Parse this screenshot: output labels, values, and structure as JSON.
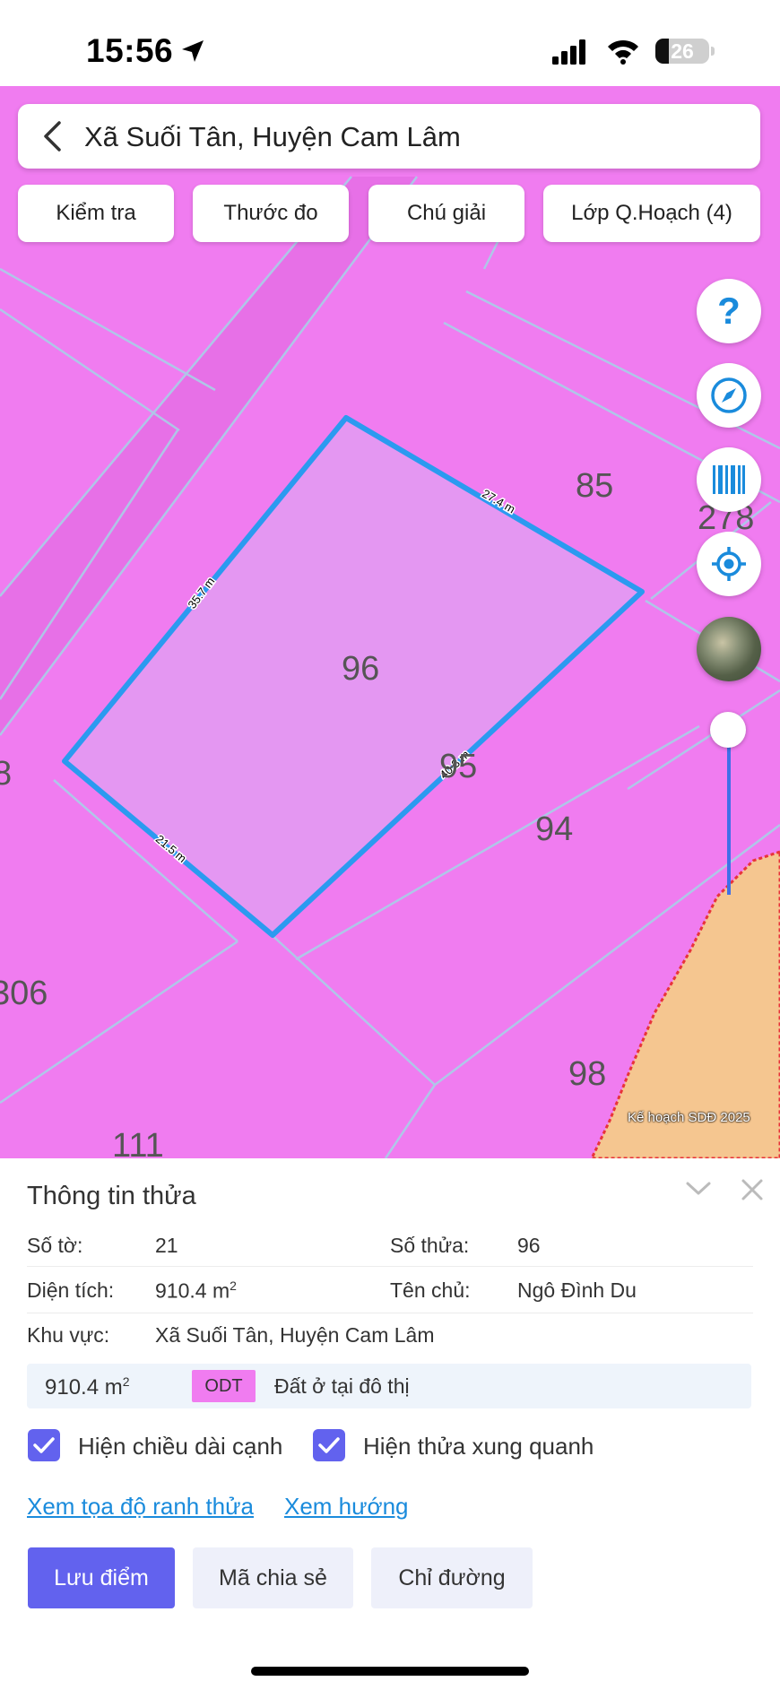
{
  "status_bar": {
    "time": "15:56",
    "battery": "26"
  },
  "map": {
    "location_title": "Xã Suối Tân, Huyện Cam Lâm",
    "tools": [
      "Kiểm tra",
      "Thước đo",
      "Chú giải",
      "Lớp Q.Hoạch (4)"
    ],
    "help_glyph": "?",
    "parcel_numbers": [
      "96",
      "85",
      "278",
      "95",
      "94",
      "98",
      "306",
      "111",
      "8"
    ],
    "edge_lengths": [
      "35.7 m",
      "27.4 m",
      "40.3 m",
      "21.5 m"
    ],
    "attribution": "Kế hoạch SDĐ 2025",
    "colors": {
      "residential": "#f07cf0",
      "selected_fill": "#e497f2",
      "selected_edge": "#2b9af0",
      "other_zone": "#f5c690"
    }
  },
  "panel": {
    "title": "Thông tin thửa",
    "sheet_label": "Số tờ:",
    "sheet_value": "21",
    "parcel_label": "Số thửa:",
    "parcel_value": "96",
    "area_label": "Diện tích:",
    "area_value": "910.4 m",
    "area_unit_sup": "2",
    "owner_label": "Tên chủ:",
    "owner_value": "Ngô Đình Du",
    "region_label": "Khu vực:",
    "region_value": "Xã Suối Tân, Huyện Cam Lâm",
    "land_use": {
      "area": "910.4 m",
      "unit_sup": "2",
      "code": "ODT",
      "description": "Đất ở tại đô thị"
    },
    "checkboxes": [
      "Hiện chiều dài cạnh",
      "Hiện thửa xung quanh"
    ],
    "links": [
      "Xem tọa độ ranh thửa",
      "Xem hướng"
    ],
    "buttons": {
      "save": "Lưu điểm",
      "share": "Mã chia sẻ",
      "directions": "Chỉ đường"
    }
  }
}
